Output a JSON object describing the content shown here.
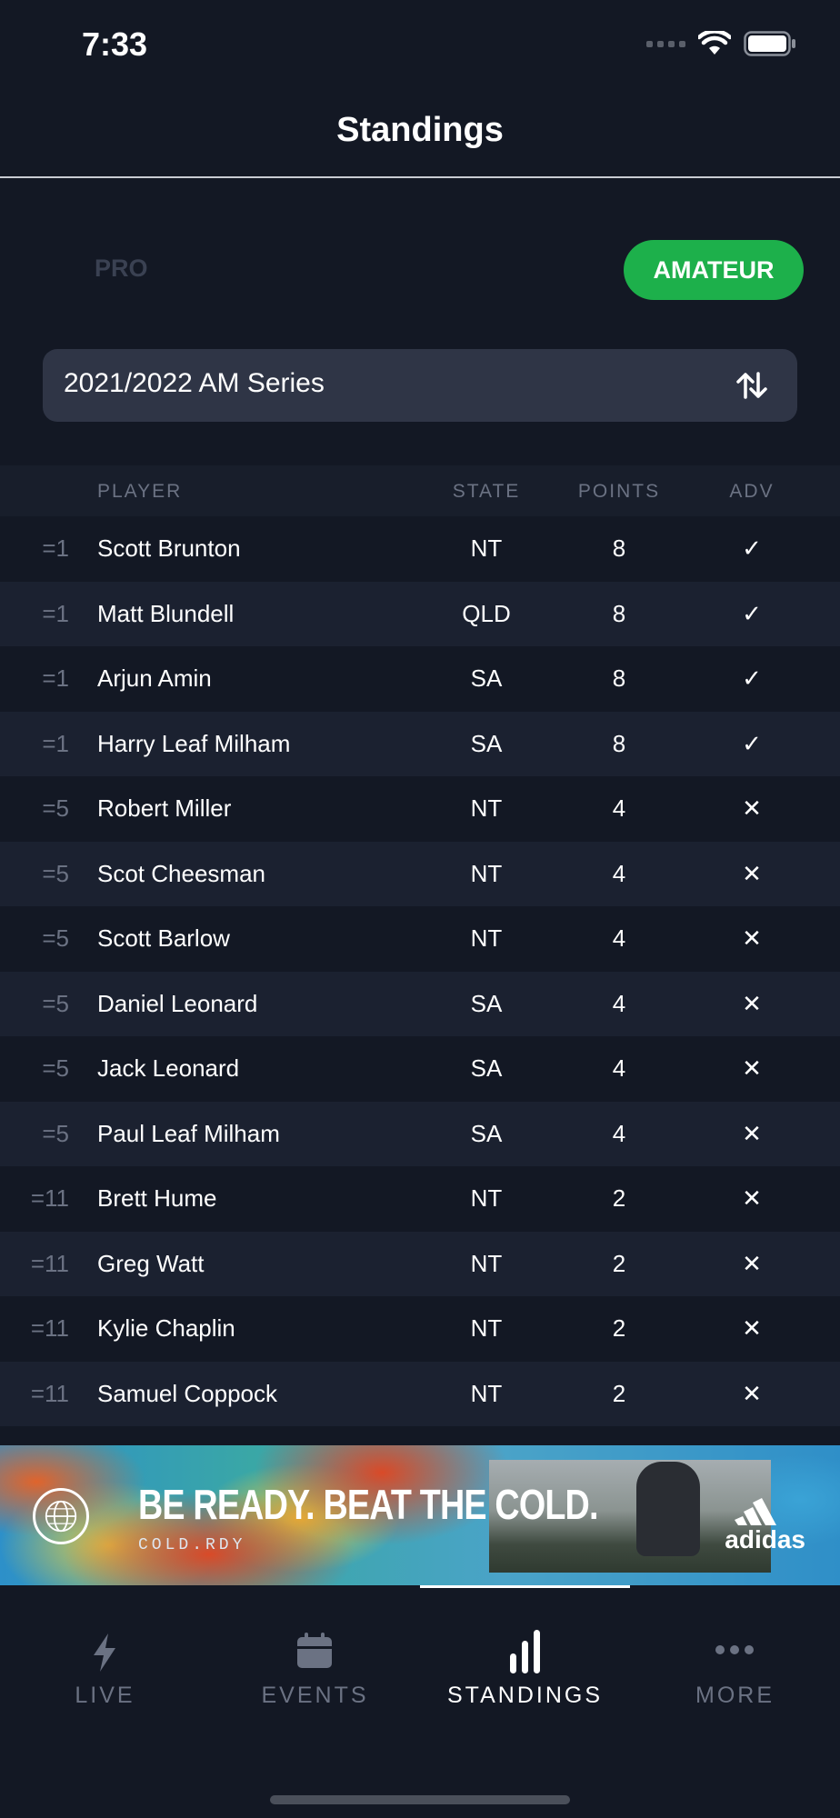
{
  "status_bar": {
    "time": "7:33"
  },
  "header": {
    "title": "Standings"
  },
  "segment": {
    "pro": "PRO",
    "amateur": "AMATEUR",
    "selected": "AMATEUR",
    "accent": "#1db04b"
  },
  "series": {
    "selected": "2021/2022 AM Series"
  },
  "table": {
    "headers": {
      "player": "PLAYER",
      "state": "STATE",
      "points": "POINTS",
      "adv": "ADV"
    },
    "rows": [
      {
        "rank": "=1",
        "name": "Scott Brunton",
        "state": "NT",
        "points": "8",
        "adv": "✓"
      },
      {
        "rank": "=1",
        "name": "Matt Blundell",
        "state": "QLD",
        "points": "8",
        "adv": "✓"
      },
      {
        "rank": "=1",
        "name": "Arjun Amin",
        "state": "SA",
        "points": "8",
        "adv": "✓"
      },
      {
        "rank": "=1",
        "name": "Harry Leaf Milham",
        "state": "SA",
        "points": "8",
        "adv": "✓"
      },
      {
        "rank": "=5",
        "name": "Robert Miller",
        "state": "NT",
        "points": "4",
        "adv": "✕"
      },
      {
        "rank": "=5",
        "name": "Scot Cheesman",
        "state": "NT",
        "points": "4",
        "adv": "✕"
      },
      {
        "rank": "=5",
        "name": "Scott Barlow",
        "state": "NT",
        "points": "4",
        "adv": "✕"
      },
      {
        "rank": "=5",
        "name": "Daniel Leonard",
        "state": "SA",
        "points": "4",
        "adv": "✕"
      },
      {
        "rank": "=5",
        "name": "Jack Leonard",
        "state": "SA",
        "points": "4",
        "adv": "✕"
      },
      {
        "rank": "=5",
        "name": "Paul Leaf Milham",
        "state": "SA",
        "points": "4",
        "adv": "✕"
      },
      {
        "rank": "=11",
        "name": "Brett Hume",
        "state": "NT",
        "points": "2",
        "adv": "✕"
      },
      {
        "rank": "=11",
        "name": "Greg Watt",
        "state": "NT",
        "points": "2",
        "adv": "✕"
      },
      {
        "rank": "=11",
        "name": "Kylie Chaplin",
        "state": "NT",
        "points": "2",
        "adv": "✕"
      },
      {
        "rank": "=11",
        "name": "Samuel Coppock",
        "state": "NT",
        "points": "2",
        "adv": "✕"
      }
    ]
  },
  "ad": {
    "headline": "BE READY. BEAT THE COLD.",
    "subline": "COLD.RDY",
    "brand": "adidas"
  },
  "tabs": [
    {
      "label": "LIVE",
      "icon": "lightning-icon",
      "active": false
    },
    {
      "label": "EVENTS",
      "icon": "calendar-icon",
      "active": false
    },
    {
      "label": "STANDINGS",
      "icon": "bar-chart-icon",
      "active": true
    },
    {
      "label": "MORE",
      "icon": "more-dots-icon",
      "active": false
    }
  ]
}
